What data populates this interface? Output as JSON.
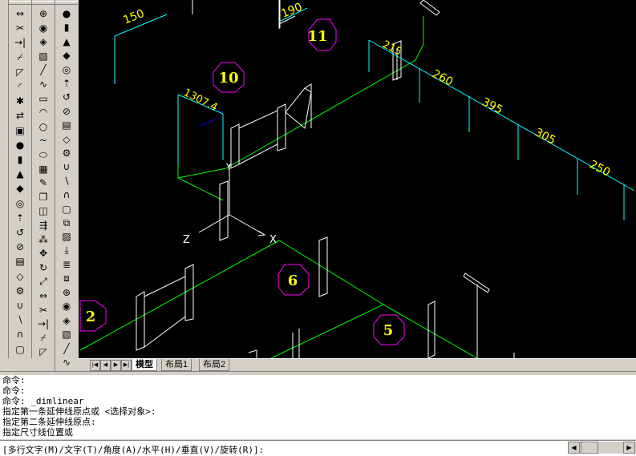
{
  "drawing": {
    "dimensions": [
      "150",
      "190",
      "1307.4",
      "215",
      "260",
      "395",
      "305",
      "250"
    ],
    "markers": [
      "11",
      "10",
      "6",
      "2",
      "5"
    ],
    "ucs": {
      "z": "Z",
      "x": "X",
      "y": "Y"
    }
  },
  "layout_tabs": {
    "model": "模型",
    "layout1": "布局1",
    "layout2": "布局2"
  },
  "command_history": [
    "命令:",
    "命令:",
    "命令: _dimlinear",
    "指定第一条延伸线原点或 <选择对象>:",
    "指定第二条延伸线原点:",
    "指定尺寸线位置或"
  ],
  "command_prompt": "[多行文字(M)/文字(T)/角度(A)/水平(H)/垂直(V)/旋转(R)]:",
  "colors": {
    "canvas": "#000000",
    "pipe": "#00ff00",
    "dimension": "#00ffff",
    "dim_text": "#ffff00",
    "marker": "#ff00ff",
    "geometry": "#ffffff"
  },
  "toolbar_icons": {
    "col0": [
      "line-icon",
      "polyline-icon",
      "rectangle-icon",
      "arc-icon",
      "circle-icon",
      "spline-icon",
      "ellipse-icon",
      "hatch-icon",
      "erase-icon",
      "copy-icon",
      "mirror-icon",
      "offset-icon",
      "array-icon",
      "move-icon",
      "rotate-icon",
      "scale-icon",
      "stretch-icon",
      "trim-icon",
      "extend-icon",
      "break-icon",
      "chamfer-icon",
      "fillet-icon",
      "explode-icon",
      "match-icon"
    ],
    "col1": [
      "box-icon",
      "sphere-icon",
      "cylinder-icon",
      "cone-icon",
      "wedge-icon",
      "torus-icon",
      "extrude-icon",
      "revolve-icon",
      "slice-icon",
      "section-icon",
      "interfere-icon",
      "setup-icon",
      "union-icon",
      "subtract-icon",
      "intersect-icon",
      "tab-icon",
      "copy-tool-icon",
      "block-icon",
      "insert-icon",
      "attrib-icon",
      "xref-icon",
      "ucs-icon",
      "view-icon",
      "layer-icon",
      "render-icon"
    ],
    "col2": [
      "face-icon",
      "wedge2-icon",
      "dome-icon",
      "dish-icon",
      "mesh-icon",
      "revsurf-icon",
      "tabsurf-icon",
      "rulesurf-icon",
      "edgesurf-icon",
      "shade-icon",
      "3dorbit-icon",
      "extrude-face-icon",
      "move-face-icon",
      "offset-face-icon",
      "delete-face-icon",
      "rotate-face-icon",
      "taper-face-icon",
      "copy-face-icon",
      "color-face-icon",
      "imprint-icon",
      "separate-icon",
      "shell-icon",
      "check-icon",
      "text-icon",
      "mtext-icon",
      "tolerance-icon"
    ]
  }
}
